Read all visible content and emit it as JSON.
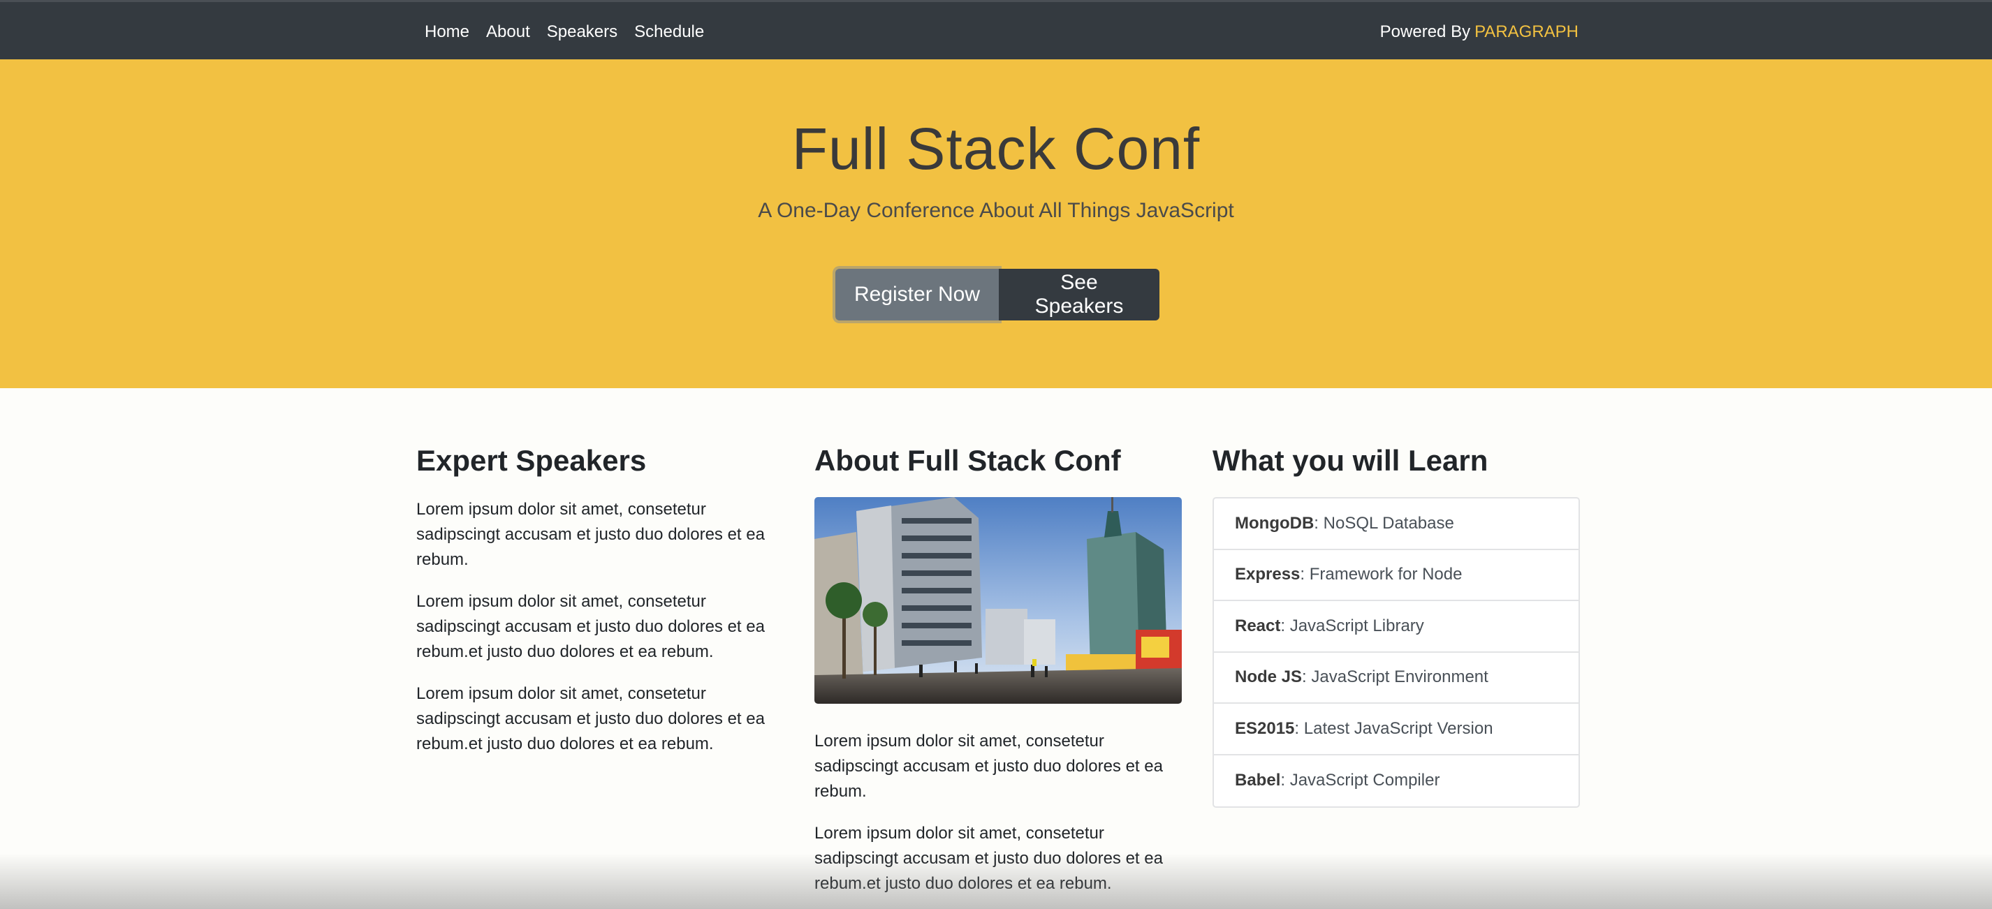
{
  "nav": {
    "links": [
      "Home",
      "About",
      "Speakers",
      "Schedule"
    ],
    "powered_prefix": "Powered By",
    "powered_brand": "PARAGRAPH"
  },
  "hero": {
    "title": "Full Stack Conf",
    "subtitle": "A One-Day Conference About All Things JavaScript",
    "register_label": "Register Now",
    "speakers_label": "See Speakers"
  },
  "speakers": {
    "heading": "Expert Speakers",
    "paragraphs": [
      "Lorem ipsum dolor sit amet, consetetur sadipscingt accusam et justo duo dolores et ea rebum.",
      "Lorem ipsum dolor sit amet, consetetur sadipscingt accusam et justo duo dolores et ea rebum.et justo duo dolores et ea rebum.",
      "Lorem ipsum dolor sit amet, consetetur sadipscingt accusam et justo duo dolores et ea rebum.et justo duo dolores et ea rebum."
    ]
  },
  "about": {
    "heading": "About Full Stack Conf",
    "paragraphs": [
      "Lorem ipsum dolor sit amet, consetetur sadipscingt accusam et justo duo dolores et ea rebum.",
      "Lorem ipsum dolor sit amet, consetetur sadipscingt accusam et justo duo dolores et ea rebum.et justo duo dolores et ea rebum."
    ]
  },
  "learn": {
    "heading": "What you will Learn",
    "items": [
      {
        "name": "MongoDB",
        "desc": ": NoSQL Database"
      },
      {
        "name": "Express",
        "desc": ": Framework for Node"
      },
      {
        "name": "React",
        "desc": ": JavaScript Library"
      },
      {
        "name": "Node JS",
        "desc": ": JavaScript Environment"
      },
      {
        "name": "ES2015",
        "desc": ": Latest JavaScript Version"
      },
      {
        "name": "Babel",
        "desc": ": JavaScript Compiler"
      }
    ]
  },
  "colors": {
    "navbar": "#343a40",
    "hero": "#f2c142",
    "brand": "#f2c141",
    "btn_primary": "#6c757d",
    "btn_dark": "#343a40"
  }
}
